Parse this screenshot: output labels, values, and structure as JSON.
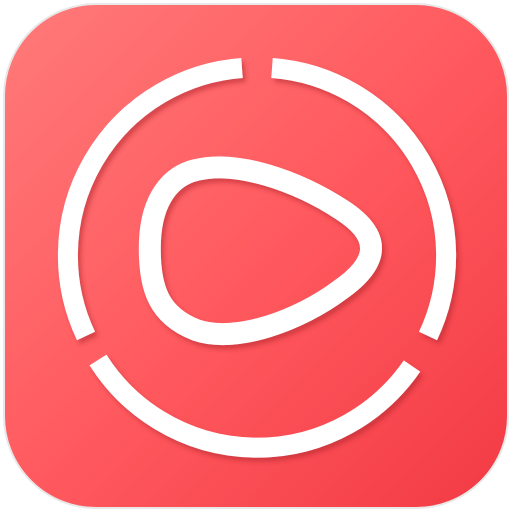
{
  "icon": {
    "name": "video-player-app-icon",
    "symbol": "play-ring-icon",
    "colors": {
      "background_top_left": "#ff7a7a",
      "background_mid": "#ff5a5f",
      "background_bottom_right": "#f33a44",
      "foreground": "#ffffff",
      "shadow": "#b3262e"
    }
  }
}
